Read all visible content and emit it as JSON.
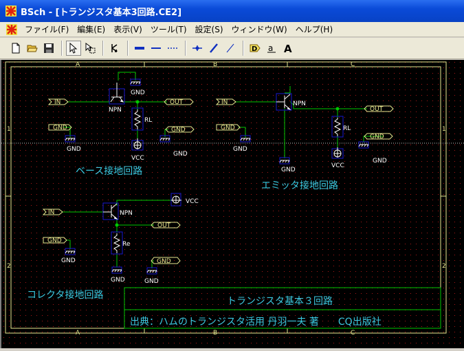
{
  "window": {
    "title": "BSch - [トランジスタ基本3回路.CE2]"
  },
  "menu": {
    "items": [
      {
        "label": "ファイル(F)"
      },
      {
        "label": "編集(E)"
      },
      {
        "label": "表示(V)"
      },
      {
        "label": "ツール(T)"
      },
      {
        "label": "設定(S)"
      },
      {
        "label": "ウィンドウ(W)"
      },
      {
        "label": "ヘルプ(H)"
      }
    ]
  },
  "toolbar": {
    "buttons": [
      {
        "icon": "new-file-icon"
      },
      {
        "icon": "open-folder-icon"
      },
      {
        "icon": "save-icon"
      },
      {
        "icon": "select-pointer-icon"
      },
      {
        "icon": "drag-select-icon"
      },
      {
        "icon": "component-icon"
      },
      {
        "icon": "wire-icon"
      },
      {
        "icon": "bus-icon"
      },
      {
        "icon": "dash-line-icon"
      },
      {
        "icon": "junction-icon"
      },
      {
        "icon": "entry-icon"
      },
      {
        "icon": "bus-entry-icon"
      },
      {
        "icon": "tag-icon"
      },
      {
        "icon": "label-icon"
      },
      {
        "icon": "comment-icon"
      }
    ],
    "tag_glyph": "D",
    "label_glyph": "a",
    "comment_glyph": "A"
  },
  "frame": {
    "col_labels": [
      "A",
      "B",
      "C"
    ],
    "row_labels": [
      "1",
      "2"
    ]
  },
  "circuits": {
    "common_base": {
      "caption": "ベース接地回路",
      "in": "IN",
      "out": "OUT",
      "gnd_tag": "GND",
      "transistor": "NPN",
      "resistor": "RL",
      "vcc": "VCC",
      "gnd_top": "GND",
      "gnd_a": "GND",
      "gnd_b": "GND"
    },
    "common_emitter_follower": {
      "caption": "エミッタ接地回路",
      "in": "IN",
      "out": "OUT",
      "gnd_tag": "GND",
      "transistor": "NPN",
      "resistor": "RL",
      "vcc": "VCC",
      "gnd_a": "GND",
      "gnd_b": "GND",
      "gnd_c": "GND"
    },
    "common_collector": {
      "caption": "コレクタ接地回路",
      "in": "IN",
      "out": "OUT",
      "gnd_tag": "GND",
      "transistor": "NPN",
      "resistor": "Re",
      "vcc": "VCC",
      "gnd_a": "GND",
      "gnd_b": "GND",
      "gnd_c": "GND",
      "gnd_tag2": "GND"
    }
  },
  "title_block": {
    "title": "トランジスタ基本３回路",
    "source": "出典：ハムのトランジスタ活用 丹羽一夫 著　　CQ出版社"
  },
  "colors": {
    "wire": "#00c800",
    "component": "#ffffff",
    "tag": "#e8e890",
    "label": "#3cc8e0",
    "frame": "#e8e890",
    "pin_box": "#1818d0"
  }
}
